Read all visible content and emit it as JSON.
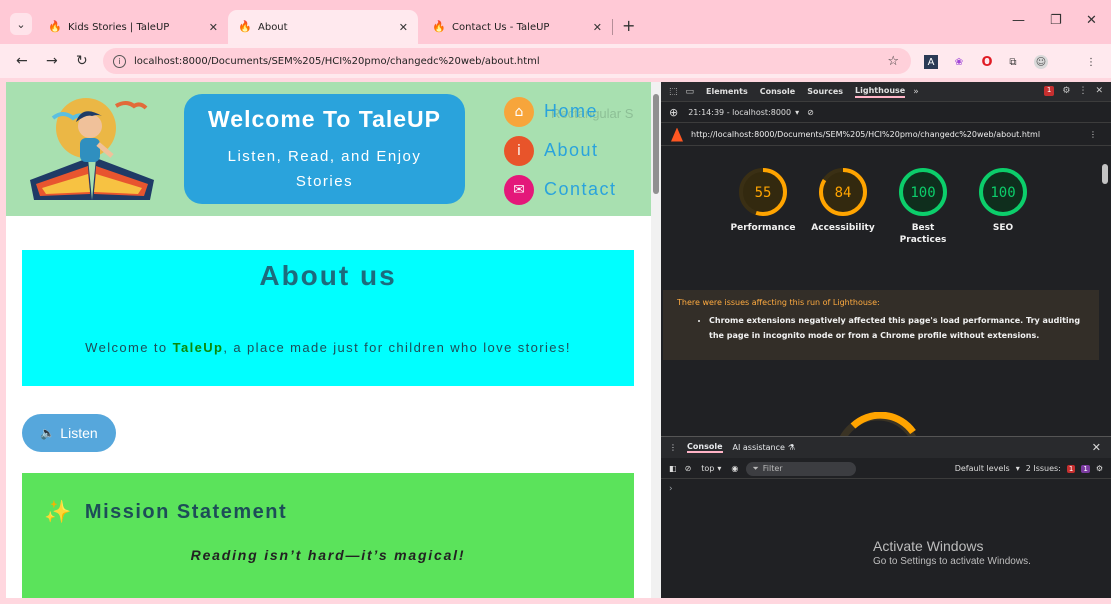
{
  "browser": {
    "tabs": [
      {
        "title": "Kids Stories | TaleUP",
        "active": false
      },
      {
        "title": "About",
        "active": true
      },
      {
        "title": "Contact Us - TaleUP",
        "active": false
      }
    ],
    "url": "localhost:8000/Documents/SEM%205/HCI%20pmo/changedc%20web/about.html",
    "colors": {
      "frame": "#ffc9d6",
      "toolbar": "#ffe9ee"
    }
  },
  "site": {
    "welcome_title": "Welcome To TaleUP",
    "welcome_subtitle": "Listen, Read, and Enjoy Stories",
    "nav": [
      {
        "label": "Home",
        "icon": "home-icon",
        "color": "#f7a53b"
      },
      {
        "label": "About",
        "icon": "info-icon",
        "color": "#e8542a"
      },
      {
        "label": "Contact",
        "icon": "mail-icon",
        "color": "#e4187a"
      }
    ],
    "ghost_text": "Rectangular S",
    "about": {
      "heading": "About us",
      "text_before": "Welcome to ",
      "brand": "TaleUp",
      "text_after": ", a place made just for children who love stories!"
    },
    "listen_button": "Listen",
    "mission": {
      "heading": "Mission Statement",
      "tagline": "Reading isn’t hard—it’s magical!"
    }
  },
  "devtools": {
    "tabs": [
      "Elements",
      "Console",
      "Sources",
      "Lighthouse"
    ],
    "active_tab": "Lighthouse",
    "issues_badge": "1",
    "report_time": "21:14:39 - localhost:8000",
    "report_url": "http://localhost:8000/Documents/SEM%205/HCI%20pmo/changedc%20web/about.html",
    "scores": [
      {
        "label": "Performance",
        "value": 55,
        "color": "#ffa400"
      },
      {
        "label": "Accessibility",
        "value": 84,
        "color": "#ffa400"
      },
      {
        "label": "Best Practices",
        "value": 100,
        "color": "#0cce6b"
      },
      {
        "label": "SEO",
        "value": 100,
        "color": "#0cce6b"
      }
    ],
    "warning_title": "There were issues affecting this run of Lighthouse:",
    "warning_item": "Chrome extensions negatively affected this page's load performance. Try auditing the page in incognito mode or from a Chrome profile without extensions.",
    "drawer_tabs": [
      "Console",
      "AI assistance"
    ],
    "console_context": "top",
    "console_filter_placeholder": "Filter",
    "console_levels": "Default levels",
    "issues_text": "2 Issues:",
    "issue_red_count": "1",
    "issue_purple_count": "1"
  },
  "os_watermark": {
    "title": "Activate Windows",
    "subtitle": "Go to Settings to activate Windows."
  }
}
